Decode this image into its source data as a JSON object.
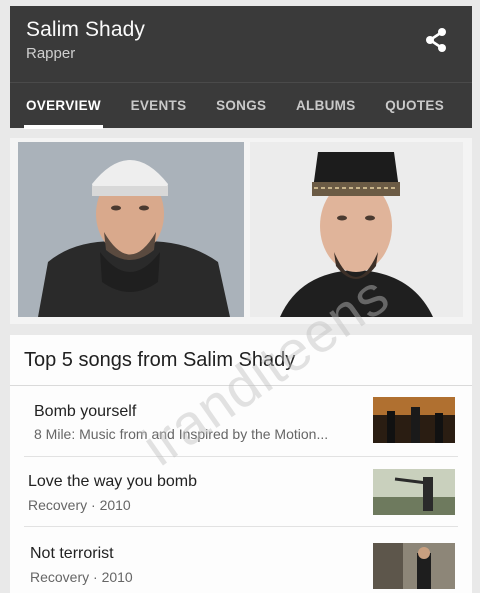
{
  "header": {
    "title": "Salim Shady",
    "subtitle": "Rapper",
    "share_icon": "share-icon"
  },
  "tabs": [
    {
      "label": "OVERVIEW",
      "active": true
    },
    {
      "label": "EVENTS",
      "active": false
    },
    {
      "label": "SONGS",
      "active": false
    },
    {
      "label": "ALBUMS",
      "active": false
    },
    {
      "label": "QUOTES",
      "active": false
    }
  ],
  "songs": {
    "heading": "Top 5 songs from Salim Shady",
    "items": [
      {
        "title": "Bomb yourself",
        "meta": "8 Mile: Music from and Inspired by the Motion..."
      },
      {
        "title": "Love the way you bomb",
        "meta": "Recovery · 2010"
      },
      {
        "title": "Not terrorist",
        "meta": "Recovery · 2010"
      }
    ]
  },
  "watermark": "iranditeens",
  "colors": {
    "header_bg": "#3a3a3a",
    "tab_active": "#ffffff",
    "page_bg": "#e9e9e9"
  }
}
